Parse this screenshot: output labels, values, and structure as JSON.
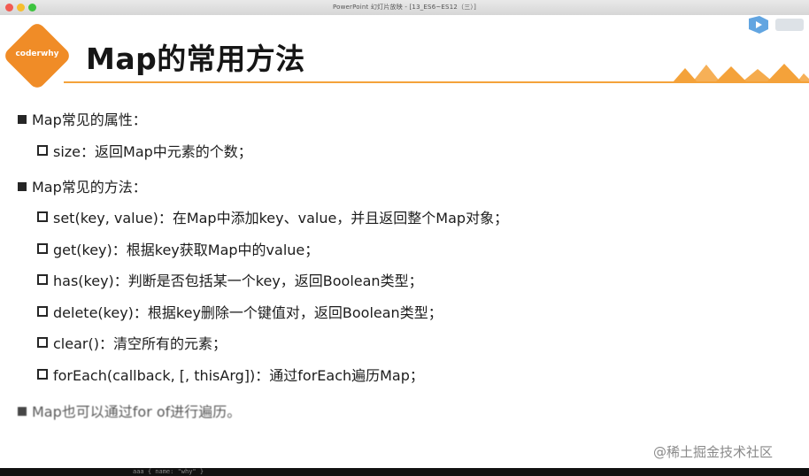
{
  "window": {
    "title": "PowerPoint 幻灯片放映 - [13_ES6~ES12（三）]"
  },
  "logo": {
    "text": "coderwhy",
    "color": "#f08c27"
  },
  "slide": {
    "title": "Map的常用方法",
    "accent_color": "#f4a23a"
  },
  "bullets": [
    {
      "level": 1,
      "text": "Map常见的属性："
    },
    {
      "level": 2,
      "text": "size：返回Map中元素的个数；"
    },
    {
      "level": 1,
      "text": "Map常见的方法："
    },
    {
      "level": 2,
      "text": "set(key, value)：在Map中添加key、value，并且返回整个Map对象；"
    },
    {
      "level": 2,
      "text": "get(key)：根据key获取Map中的value；"
    },
    {
      "level": 2,
      "text": "has(key)：判断是否包括某一个key，返回Boolean类型；"
    },
    {
      "level": 2,
      "text": "delete(key)：根据key删除一个键值对，返回Boolean类型；"
    },
    {
      "level": 2,
      "text": "clear()：清空所有的元素；"
    },
    {
      "level": 2,
      "text": "forEach(callback, [, thisArg])：通过forEach遍历Map；"
    },
    {
      "level": 1,
      "text": "Map也可以通过for of进行遍历。"
    }
  ],
  "watermark": "@稀土掘金技术社区",
  "bottom_code": "aaa { name: \"why\" }"
}
